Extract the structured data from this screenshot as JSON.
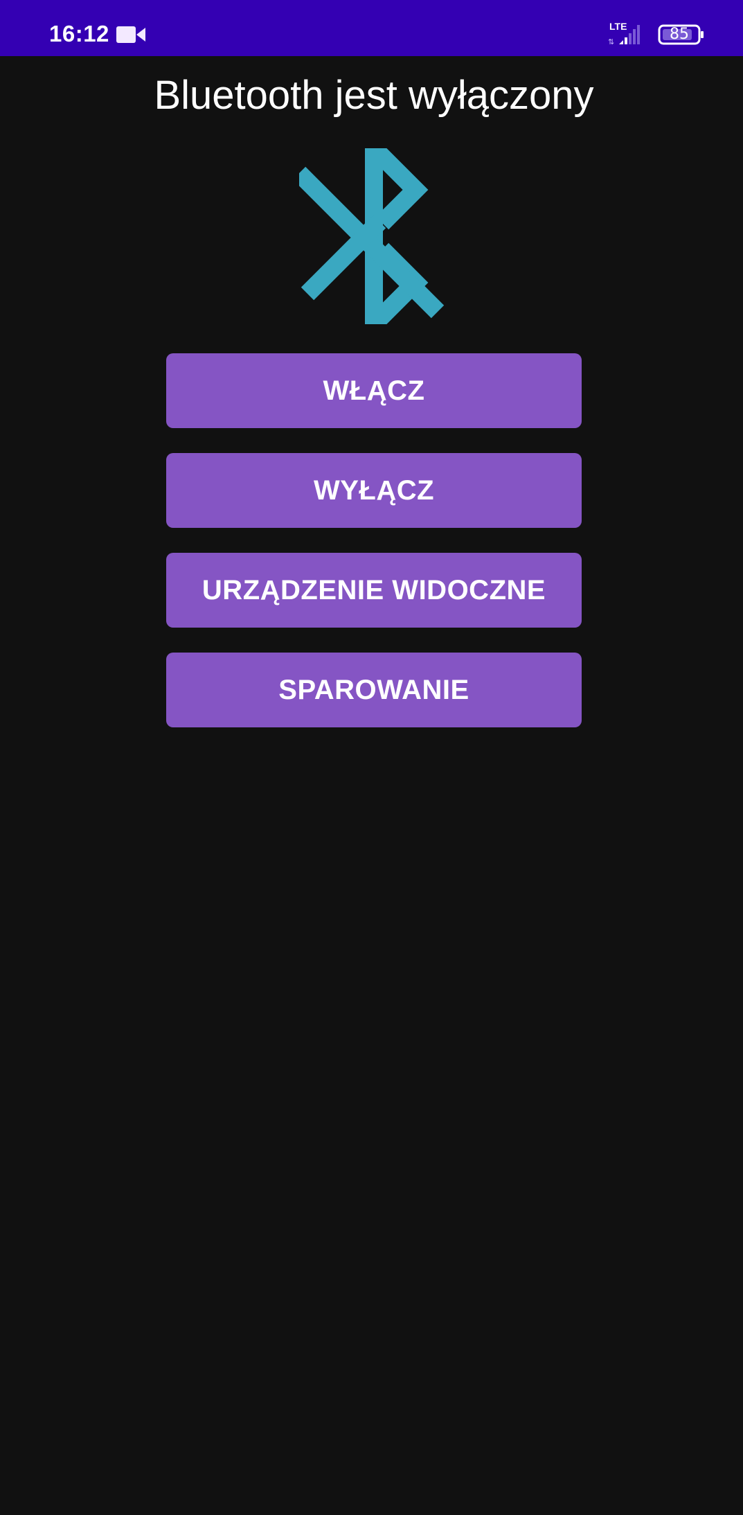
{
  "status_bar": {
    "time": "16:12",
    "network": "LTE",
    "battery": "85",
    "video_icon": "video-camera-icon",
    "signal_icon": "signal-strength-icon",
    "battery_icon": "battery-icon",
    "background_color": "#3400b3"
  },
  "header": {
    "title": "Bluetooth jest wyłączony"
  },
  "main": {
    "icon": "bluetooth-icon",
    "icon_color": "#3aa8c1",
    "buttons": [
      {
        "label": "WŁĄCZ"
      },
      {
        "label": "WYŁĄCZ"
      },
      {
        "label": "URZĄDZENIE WIDOCZNE"
      },
      {
        "label": "SPAROWANIE"
      }
    ],
    "button_color": "#8555c4"
  },
  "background_color": "#111111"
}
